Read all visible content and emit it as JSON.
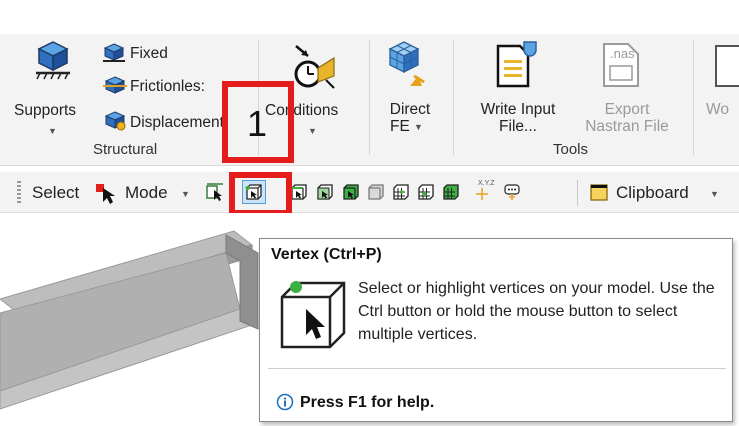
{
  "ribbon": {
    "structural": {
      "supports_label": "Supports",
      "fixed_label": "Fixed",
      "frictionless_label": "Frictionles:",
      "displacement_label": "Displacement",
      "group_label": "Structural"
    },
    "conditions_label": "Conditions",
    "direct_fe": {
      "line1": "Direct",
      "line2": "FE"
    },
    "tools": {
      "write_input_line1": "Write Input",
      "write_input_line2": "File...",
      "nas_ext": ".nas",
      "export_line1": "Export",
      "export_line2": "Nastran File",
      "group_label": "Tools"
    },
    "partial_label": "Wo"
  },
  "annotation": {
    "step_number": "1"
  },
  "toolbar": {
    "select_label": "Select",
    "mode_label": "Mode",
    "clipboard_label": "Clipboard",
    "xyz_label": "X.Y.Z"
  },
  "tooltip": {
    "title": "Vertex (Ctrl+P)",
    "description": "Select or highlight vertices on your model. Use the Ctrl button or hold the mouse button to select multiple vertices.",
    "help": "Press F1 for help."
  },
  "colors": {
    "highlight_red": "#e41c1c",
    "ribbon_bg": "#f3f3f3",
    "selected_tool_bg": "#cce4f7",
    "vertex_green": "#3cb043"
  }
}
